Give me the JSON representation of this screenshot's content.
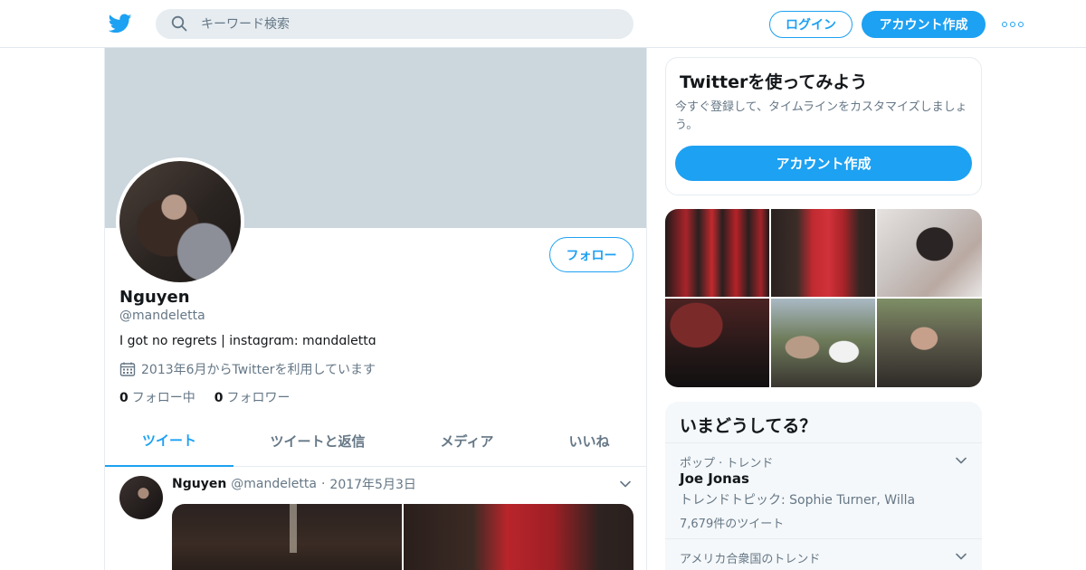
{
  "header": {
    "search_placeholder": "キーワード検索",
    "login_label": "ログイン",
    "signup_label": "アカウント作成",
    "accent_color": "#1da1f2"
  },
  "profile": {
    "name": "Nguyen",
    "handle": "@mandeletta",
    "bio": "I got no regrets | instɑgrɑm: mɑndɑlettɑ",
    "joined": "2013年6月からTwitterを利用しています",
    "follow_label": "フォロー",
    "following_count": "0",
    "following_label": "フォロー中",
    "followers_count": "0",
    "followers_label": "フォロワー"
  },
  "tabs": [
    {
      "label": "ツイート",
      "active": true
    },
    {
      "label": "ツイートと返信",
      "active": false
    },
    {
      "label": "メディア",
      "active": false
    },
    {
      "label": "いいね",
      "active": false
    }
  ],
  "tweet": {
    "name": "Nguyen",
    "handle": "@mandeletta",
    "separator": "·",
    "date": "2017年5月3日"
  },
  "signup_card": {
    "title": "Twitterを使ってみよう",
    "description": "今すぐ登録して、タイムラインをカスタマイズしましょう。",
    "button_label": "アカウント作成"
  },
  "trends": {
    "title": "いまどうしてる？",
    "items": [
      {
        "context": "ポップ · トレンド",
        "name": "Joe Jonas",
        "subtitle": "トレンドトピック: Sophie Turner, Willa",
        "count": "7,679件のツイート"
      },
      {
        "context": "アメリカ合衆国のトレンド"
      }
    ]
  }
}
